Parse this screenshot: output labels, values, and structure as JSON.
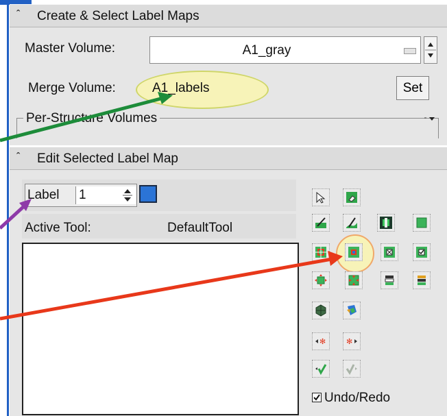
{
  "create_section": {
    "title": "Create & Select Label Maps",
    "master_volume_label": "Master Volume:",
    "master_volume_value": "A1_gray",
    "merge_volume_label": "Merge Volume:",
    "merge_volume_value": "A1_labels",
    "set_button": "Set",
    "per_structure_label": "Per-Structure Volumes"
  },
  "edit_section": {
    "title": "Edit Selected Label Map",
    "label_text": "Label",
    "label_value": "1",
    "label_color": "#2b74d6",
    "active_tool_label": "Active Tool:",
    "active_tool_value": "DefaultTool",
    "undo_redo_label": "Undo/Redo",
    "undo_redo_checked": true
  },
  "tools": [
    "pointer-tool-icon",
    "erase-label-tool-icon",
    "draw-tool-icon",
    "level-tracing-tool-icon",
    "paint-tool-icon",
    "fill-box-tool-icon",
    "threshold-paint-tool-icon",
    "change-label-tool-icon",
    "identify-islands-tool-icon",
    "change-island-tool-icon",
    "dilate-tool-icon",
    "erode-tool-icon",
    "save-island-tool-icon",
    "remove-islands-tool-icon",
    "make-model-tool-icon",
    "grow-cut-tool-icon",
    "previous-check-point-icon",
    "next-check-point-icon",
    "accept-tool-icon",
    "reject-tool-icon"
  ],
  "annotation_colors": {
    "green_arrow": "#1d8c3a",
    "purple_arrow": "#8e3aa8",
    "red_arrow": "#e8381a",
    "highlight": "#f7f3b8"
  }
}
